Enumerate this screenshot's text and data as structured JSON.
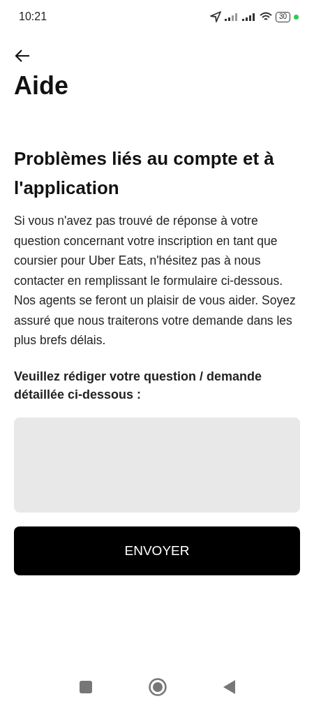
{
  "status_bar": {
    "time": "10:21",
    "battery": "30"
  },
  "header": {
    "title": "Aide"
  },
  "section": {
    "heading": "Problèmes liés au compte et à l'application",
    "body": "Si vous n'avez pas trouvé de réponse à votre question concernant votre inscription en tant que coursier pour Uber Eats, n'hésitez pas à nous contacter en remplissant le formulaire ci-dessous. Nos agents se feront un plaisir de vous aider. Soyez assuré que nous traiterons votre demande dans les plus brefs délais."
  },
  "form": {
    "label": "Veuillez rédiger votre question / demande détaillée ci-dessous :",
    "submit": "ENVOYER"
  }
}
